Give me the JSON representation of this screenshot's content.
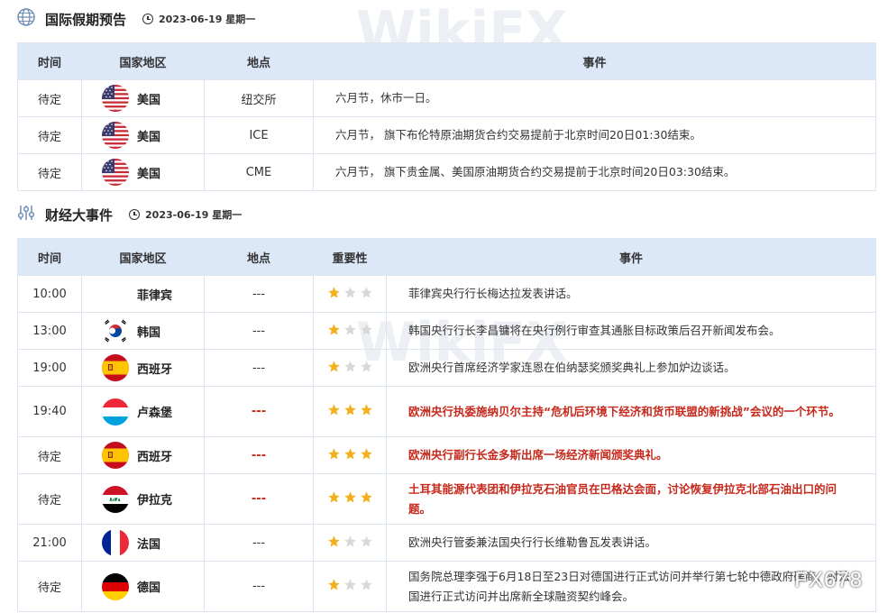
{
  "holiday_section": {
    "title": "国际假期预告",
    "date": "2023-06-19 星期一",
    "columns": [
      "时间",
      "国家地区",
      "地点",
      "事件"
    ],
    "rows": [
      {
        "time": "待定",
        "country": "美国",
        "flag": "us-flag-icon",
        "location": "纽交所",
        "event": "六月节，休市一日。"
      },
      {
        "time": "待定",
        "country": "美国",
        "flag": "us-flag-icon",
        "location": "ICE",
        "event": "六月节， 旗下布伦特原油期货合约交易提前于北京时间20日01:30结束。"
      },
      {
        "time": "待定",
        "country": "美国",
        "flag": "us-flag-icon",
        "location": "CME",
        "event": "六月节， 旗下贵金属、美国原油期货合约交易提前于北京时间20日03:30结束。"
      }
    ]
  },
  "events_section": {
    "title": "财经大事件",
    "date": "2023-06-19 星期一",
    "columns": [
      "时间",
      "国家地区",
      "地点",
      "重要性",
      "事件"
    ],
    "rows": [
      {
        "time": "10:00",
        "country": "菲律宾",
        "flag": "",
        "location": "---",
        "importance": 1,
        "important": false,
        "event": "菲律宾央行行长梅达拉发表讲话。"
      },
      {
        "time": "13:00",
        "country": "韩国",
        "flag": "kr-flag-icon",
        "location": "---",
        "importance": 1,
        "important": false,
        "event": "韩国央行行长李昌镛将在央行例行审查其通胀目标政策后召开新闻发布会。"
      },
      {
        "time": "19:00",
        "country": "西班牙",
        "flag": "es-flag-icon",
        "location": "---",
        "importance": 1,
        "important": false,
        "event": "欧洲央行首席经济学家连恩在伯纳瑟奖颁奖典礼上参加炉边谈话。"
      },
      {
        "time": "19:40",
        "country": "卢森堡",
        "flag": "lu-flag-icon",
        "location": "---",
        "importance": 3,
        "important": true,
        "event": "欧洲央行执委施纳贝尔主持“危机后环境下经济和货币联盟的新挑战”会议的一个环节。"
      },
      {
        "time": "待定",
        "country": "西班牙",
        "flag": "es-flag-icon",
        "location": "---",
        "importance": 3,
        "important": true,
        "event": "欧洲央行副行长金多斯出席一场经济新闻颁奖典礼。"
      },
      {
        "time": "待定",
        "country": "伊拉克",
        "flag": "iq-flag-icon",
        "location": "---",
        "importance": 3,
        "important": true,
        "event": "土耳其能源代表团和伊拉克石油官员在巴格达会面，讨论恢复伊拉克北部石油出口的问题。"
      },
      {
        "time": "21:00",
        "country": "法国",
        "flag": "fr-flag-icon",
        "location": "---",
        "importance": 1,
        "important": false,
        "event": "欧洲央行管委兼法国央行行长维勒鲁瓦发表讲话。"
      },
      {
        "time": "待定",
        "country": "德国",
        "flag": "de-flag-icon",
        "location": "---",
        "importance": 1,
        "important": false,
        "event": "国务院总理李强于6月18日至23日对德国进行正式访问并举行第七轮中德政府磋商、对法国进行正式访问并出席新全球融资契约峰会。"
      }
    ]
  },
  "watermarks": {
    "brand": "WikiFX",
    "corner": "FX678"
  },
  "colors": {
    "header_bg": "#dce8f8",
    "border": "#dde6f0",
    "important_red": "#c6281b",
    "star_gold": "#f2b01e",
    "star_gray": "#d8d8d8"
  }
}
